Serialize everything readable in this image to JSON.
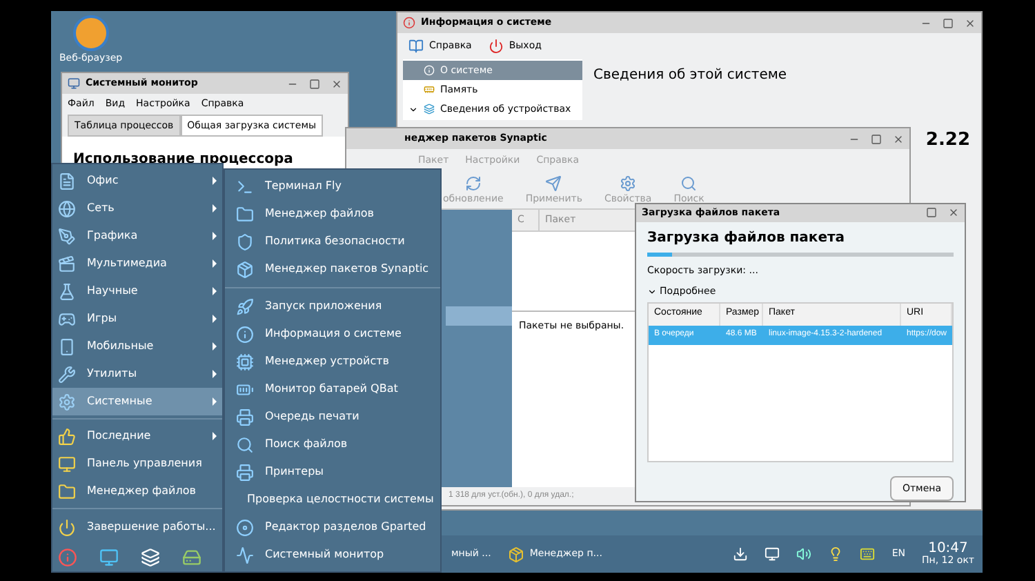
{
  "desktop_icon": {
    "label": "Веб-браузер"
  },
  "system_monitor": {
    "title": "Системный монитор",
    "menu": [
      "Файл",
      "Вид",
      "Настройка",
      "Справка"
    ],
    "tabs": [
      {
        "label": "Таблица процессов",
        "selected": false
      },
      {
        "label": "Общая загрузка системы",
        "selected": true
      }
    ],
    "heading": "Использование процессора"
  },
  "system_info": {
    "title": "Информация о системе",
    "toolbar": [
      "Справка",
      "Выход"
    ],
    "tree": [
      {
        "label": "О системе",
        "selected": true
      },
      {
        "label": "Память",
        "selected": false
      },
      {
        "label": "Сведения об устройствах",
        "selected": false,
        "expanded": true
      }
    ],
    "heading": "Сведения об этой системе",
    "version": "2.22"
  },
  "synaptic": {
    "title": "неджер пакетов Synaptic",
    "menu": [
      "Пакет",
      "Настройки",
      "Справка"
    ],
    "toolbar": [
      "обновление",
      "Применить",
      "Свойства",
      "Поиск"
    ],
    "columns": [
      "С",
      "Пакет"
    ],
    "details": "Пакеты не выбраны.",
    "status": "1 318 для уст.(обн.), 0 для удал.;"
  },
  "download_dialog": {
    "title": "Загрузка файлов пакета",
    "heading": "Загрузка файлов пакета",
    "level": 0.08,
    "speed": "Скорость загрузки: ...",
    "details_toggle": {
      "label": "Подробнее",
      "expanded": true
    },
    "columns": [
      "Состояние",
      "Размер",
      "Пакет",
      "URI"
    ],
    "rows": [
      {
        "cells": [
          "В очереди",
          "48.6 MB",
          "linux-image-4.15.3-2-hardened",
          "https://dow"
        ],
        "selected": true
      }
    ],
    "button": "Отмена"
  },
  "start_menu": {
    "categories": [
      {
        "label": "Офис",
        "selected": false
      },
      {
        "label": "Сеть",
        "selected": false
      },
      {
        "label": "Графика",
        "selected": false
      },
      {
        "label": "Мультимедиа",
        "selected": false
      },
      {
        "label": "Научные",
        "selected": false
      },
      {
        "label": "Игры",
        "selected": false
      },
      {
        "label": "Мобильные",
        "selected": false
      },
      {
        "label": "Утилиты",
        "selected": false
      },
      {
        "label": "Системные",
        "selected": true
      }
    ],
    "recent": [
      {
        "label": "Последние",
        "submenu": true
      },
      {
        "label": "Панель управления",
        "submenu": false
      },
      {
        "label": "Менеджер файлов",
        "submenu": false
      }
    ],
    "shutdown": "Завершение работы..."
  },
  "submenu": {
    "groups": [
      [
        "Терминал Fly",
        "Менеджер файлов",
        "Политика безопасности",
        "Менеджер пакетов Synaptic"
      ],
      [
        "Запуск приложения",
        "Информация о системе",
        "Менеджер устройств",
        "Монитор батарей QBat",
        "Очередь печати",
        "Поиск файлов",
        "Принтеры",
        "Проверка целостности системы",
        "Редактор разделов Gparted",
        "Системный монитор"
      ]
    ]
  },
  "taskbar": {
    "tasks": [
      "мный ...",
      "Менеджер п..."
    ],
    "language": "EN",
    "time": "10:47",
    "date": "Пн, 12 окт"
  }
}
